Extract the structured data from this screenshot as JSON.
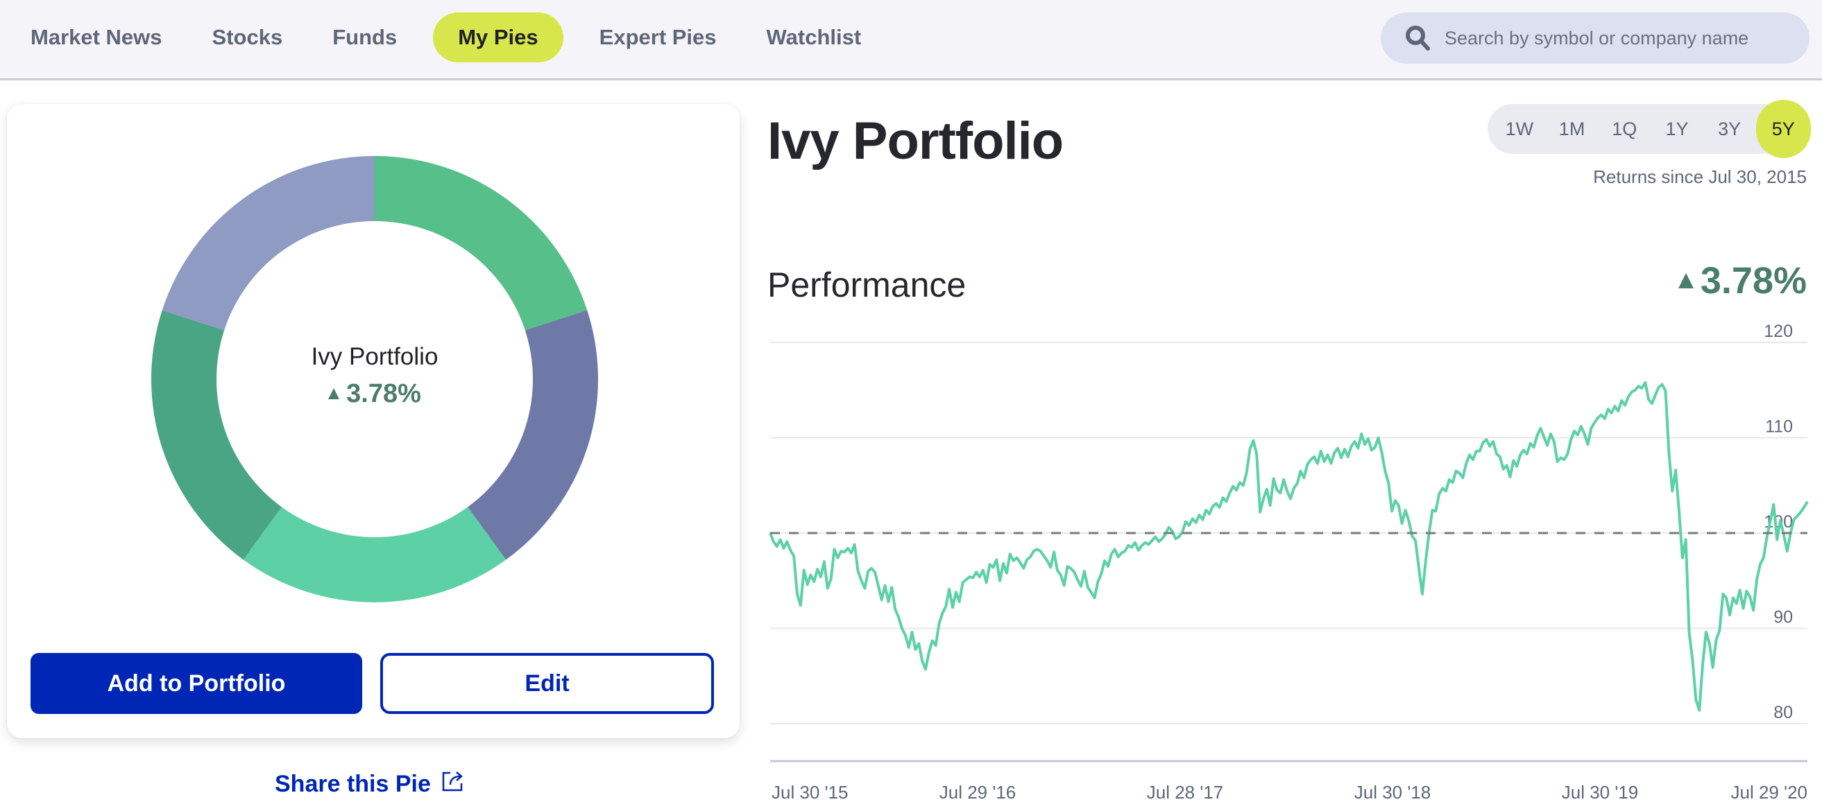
{
  "nav": {
    "items": [
      {
        "label": "Market News",
        "active": false
      },
      {
        "label": "Stocks",
        "active": false
      },
      {
        "label": "Funds",
        "active": false
      },
      {
        "label": "My Pies",
        "active": true
      },
      {
        "label": "Expert Pies",
        "active": false
      },
      {
        "label": "Watchlist",
        "active": false
      }
    ]
  },
  "search": {
    "placeholder": "Search by symbol or company name",
    "value": "",
    "icon": "search-icon"
  },
  "pie_card": {
    "center_title": "Ivy Portfolio",
    "center_change": "3.78%",
    "change_direction": "up",
    "slices": [
      {
        "share": 0.2,
        "color": "#57bf8a"
      },
      {
        "share": 0.2,
        "color": "#6f79a8"
      },
      {
        "share": 0.2,
        "color": "#5dd1a5"
      },
      {
        "share": 0.2,
        "color": "#4aa584"
      },
      {
        "share": 0.2,
        "color": "#8f9bc2"
      }
    ],
    "add_button": "Add to Portfolio",
    "edit_button": "Edit",
    "share_link": "Share this Pie"
  },
  "header": {
    "title": "Ivy Portfolio",
    "ranges": [
      {
        "label": "1W",
        "active": false
      },
      {
        "label": "1M",
        "active": false
      },
      {
        "label": "1Q",
        "active": false
      },
      {
        "label": "1Y",
        "active": false
      },
      {
        "label": "3Y",
        "active": false
      },
      {
        "label": "5Y",
        "active": true
      }
    ],
    "returns_since": "Returns since Jul 30, 2015"
  },
  "performance": {
    "label": "Performance",
    "value": "3.78%",
    "direction": "up"
  },
  "colors": {
    "accent": "#d7e64b",
    "brand_blue": "#0026b5",
    "positive": "#4a7d6a",
    "line": "#5dd1a5",
    "grid": "#e6e8ef",
    "baseline": "#7a7a7a"
  },
  "chart_data": {
    "type": "line",
    "title": "Performance",
    "xlabel": "",
    "ylabel": "",
    "ylim": [
      80,
      120
    ],
    "yticks": [
      80,
      90,
      100,
      110,
      120
    ],
    "ytick_labels": [
      "80",
      "90",
      "100",
      "110",
      "120"
    ],
    "xtick_labels": [
      "Jul 30 '15",
      "Jul 29 '16",
      "Jul 28 '17",
      "Jul 30 '18",
      "Jul 30 '19",
      "Jul 29 '20"
    ],
    "xtick_positions": [
      0,
      0.2,
      0.4,
      0.6,
      0.8,
      1.0
    ],
    "baseline": 100,
    "grid": true,
    "series": [
      {
        "name": "Ivy Portfolio",
        "values": [
          100.0,
          99.1,
          98.6,
          99.3,
          98.4,
          99.1,
          98.2,
          97.6,
          93.6,
          92.4,
          96.1,
          94.6,
          95.6,
          94.9,
          96.2,
          95.4,
          97.0,
          94.2,
          95.2,
          98.3,
          97.4,
          98.1,
          98.0,
          98.4,
          97.9,
          98.8,
          96.0,
          95.0,
          94.2,
          96.0,
          96.3,
          95.9,
          94.5,
          93.0,
          94.5,
          92.8,
          94.3,
          92.0,
          91.2,
          90.0,
          89.3,
          88.0,
          89.6,
          87.8,
          88.4,
          86.6,
          85.7,
          87.5,
          88.7,
          88.2,
          90.5,
          91.6,
          92.3,
          94.1,
          92.2,
          93.8,
          92.8,
          94.8,
          95.1,
          95.4,
          95.3,
          95.9,
          95.4,
          96.1,
          94.8,
          96.7,
          96.4,
          97.2,
          95.0,
          96.8,
          95.8,
          97.8,
          97.1,
          97.4,
          96.9,
          96.3,
          97.2,
          97.5,
          98.1,
          98.3,
          98.1,
          97.6,
          97.1,
          96.4,
          98.0,
          96.1,
          95.6,
          94.5,
          96.5,
          96.3,
          95.9,
          95.1,
          94.4,
          96.0,
          94.3,
          93.8,
          93.2,
          94.9,
          95.7,
          97.1,
          96.5,
          97.8,
          98.3,
          97.5,
          97.9,
          98.1,
          98.7,
          98.5,
          99.0,
          98.2,
          98.7,
          99.0,
          98.8,
          99.2,
          99.6,
          99.1,
          99.4,
          99.9,
          100.6,
          100.2,
          99.4,
          99.6,
          100.1,
          101.2,
          100.8,
          101.5,
          101.1,
          101.9,
          101.4,
          102.4,
          102.0,
          102.8,
          103.1,
          102.7,
          103.7,
          103.3,
          104.2,
          104.9,
          104.5,
          105.3,
          105.0,
          106.3,
          108.8,
          109.7,
          108.3,
          102.2,
          103.6,
          104.6,
          102.9,
          105.7,
          104.5,
          104.2,
          105.6,
          104.4,
          103.6,
          104.7,
          105.2,
          106.5,
          105.8,
          107.2,
          107.7,
          108.0,
          107.3,
          108.6,
          107.5,
          108.2,
          107.3,
          108.4,
          108.9,
          107.9,
          108.8,
          108.0,
          109.1,
          109.6,
          108.9,
          110.4,
          109.3,
          109.9,
          108.7,
          109.0,
          110.0,
          108.5,
          106.5,
          105.3,
          102.3,
          103.4,
          102.9,
          101.0,
          102.4,
          101.3,
          99.7,
          99.2,
          96.3,
          93.6,
          97.0,
          100.0,
          102.4,
          102.3,
          104.1,
          104.7,
          104.4,
          105.6,
          105.3,
          106.5,
          106.3,
          105.8,
          107.3,
          108.2,
          107.7,
          108.6,
          108.6,
          109.5,
          109.8,
          109.1,
          109.6,
          108.3,
          108.0,
          106.7,
          107.1,
          105.9,
          107.6,
          107.0,
          108.2,
          108.7,
          108.3,
          109.4,
          109.0,
          110.2,
          111.0,
          110.1,
          109.2,
          110.4,
          109.6,
          107.5,
          107.9,
          107.7,
          108.3,
          109.8,
          110.7,
          110.3,
          111.2,
          110.4,
          109.3,
          111.0,
          111.6,
          112.1,
          112.4,
          112.0,
          113.0,
          112.6,
          113.3,
          112.8,
          113.9,
          113.4,
          114.3,
          114.8,
          115.0,
          115.4,
          115.2,
          115.8,
          114.0,
          113.6,
          114.5,
          115.3,
          115.6,
          114.9,
          108.5,
          104.4,
          106.6,
          102.3,
          97.4,
          99.3,
          89.5,
          86.7,
          82.5,
          81.4,
          86.2,
          89.6,
          88.4,
          85.9,
          88.8,
          89.8,
          93.6,
          93.2,
          91.4,
          93.2,
          92.6,
          94.0,
          92.1,
          93.9,
          93.3,
          91.9,
          95.1,
          96.7,
          97.4,
          99.6,
          101.2,
          103.0,
          99.3,
          101.3,
          99.8,
          98.1,
          100.0,
          101.4,
          101.8,
          102.2,
          102.7,
          103.3
        ]
      }
    ]
  }
}
